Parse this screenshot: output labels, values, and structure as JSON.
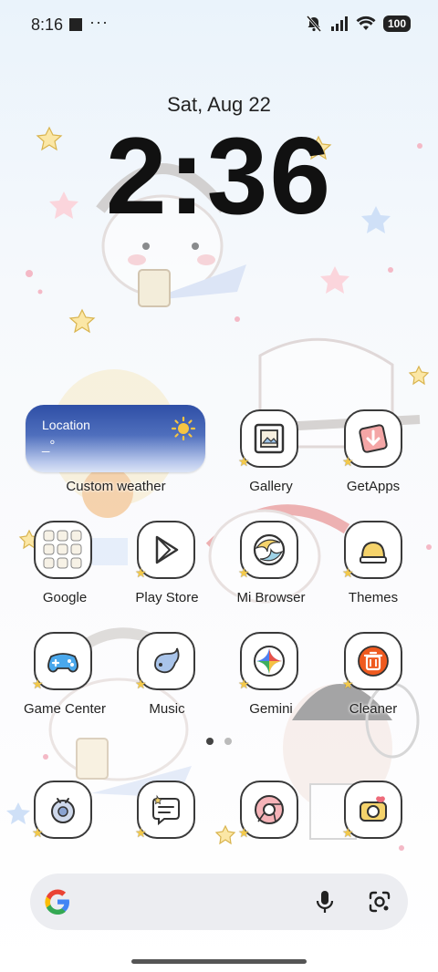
{
  "status_bar": {
    "time": "8:16",
    "dots": "···",
    "battery": "100"
  },
  "clock": {
    "date": "Sat, Aug 22",
    "time": "2:36"
  },
  "weather_widget": {
    "location": "Location",
    "temperature": "_°",
    "label": "Custom weather"
  },
  "apps": {
    "row1": [
      {
        "label": "Gallery",
        "icon": "gallery-icon"
      },
      {
        "label": "GetApps",
        "icon": "getapps-icon"
      }
    ],
    "row2": [
      {
        "label": "Google",
        "icon": "google-folder-icon"
      },
      {
        "label": "Play Store",
        "icon": "play-store-icon"
      },
      {
        "label": "Mi Browser",
        "icon": "mi-browser-icon"
      },
      {
        "label": "Themes",
        "icon": "themes-icon"
      }
    ],
    "row3": [
      {
        "label": "Game Center",
        "icon": "game-center-icon"
      },
      {
        "label": "Music",
        "icon": "music-icon"
      },
      {
        "label": "Gemini",
        "icon": "gemini-icon"
      },
      {
        "label": "Cleaner",
        "icon": "cleaner-icon"
      }
    ],
    "dock": [
      {
        "icon": "phone-icon"
      },
      {
        "icon": "messages-icon"
      },
      {
        "icon": "chrome-icon"
      },
      {
        "icon": "camera-icon"
      }
    ]
  },
  "colors": {
    "accent_star": "#f3c94a",
    "cleaner_orange": "#ef5a1f",
    "getapps_red": "#e85a5a",
    "weather_blue": "#2f4fa6"
  }
}
